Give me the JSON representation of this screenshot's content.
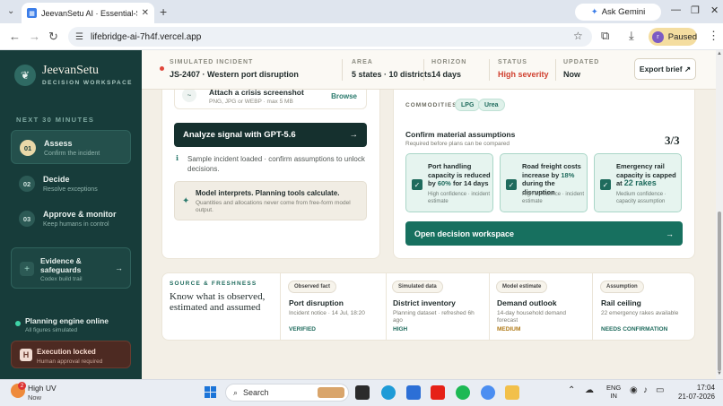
{
  "browser": {
    "tab_title": "JeevanSetu AI · Essential-Suppl",
    "ask_gemini": "Ask Gemini",
    "url": "lifebridge-ai-7h4f.vercel.app",
    "profile_initial": "r",
    "profile_status": "Paused"
  },
  "sidebar": {
    "brand": "JeevanSetu",
    "brand_sub": "DECISION WORKSPACE",
    "section": "NEXT 30 MINUTES",
    "steps": [
      {
        "num": "01",
        "label": "Assess",
        "sub": "Confirm the incident"
      },
      {
        "num": "02",
        "label": "Decide",
        "sub": "Resolve exceptions"
      },
      {
        "num": "03",
        "label": "Approve & monitor",
        "sub": "Keep humans in control"
      }
    ],
    "evidence": {
      "label": "Evidence & safeguards",
      "sub": "Codex build trail"
    },
    "engine": {
      "label": "Planning engine online",
      "sub": "All figures simulated"
    },
    "execution": {
      "label": "Execution locked",
      "sub": "Human approval required",
      "icon_letter": "H"
    }
  },
  "header": {
    "incident_label": "SIMULATED INCIDENT",
    "incident_value": "JS-2407 · Western port disruption",
    "area_label": "AREA",
    "area_value": "5 states · 10 districts",
    "horizon_label": "HORIZON",
    "horizon_value": "14 days",
    "status_label": "STATUS",
    "status_value": "High severity",
    "updated_label": "UPDATED",
    "updated_value": "Now",
    "export": "Export brief ↗",
    "status_color": "#d0402f"
  },
  "left_card": {
    "screenshot_title": "Attach a crisis screenshot",
    "screenshot_sub": "PNG, JPG or WEBP · max 5 MB",
    "browse": "Browse",
    "analyze": "Analyze signal with GPT-5.6",
    "info": "Sample incident loaded · confirm assumptions to unlock decisions.",
    "model_title": "Model interprets. Planning tools calculate.",
    "model_sub": "Quantities and allocations never come from free-form model output."
  },
  "right_card": {
    "commodities_label": "COMMODITIES",
    "commodities": [
      "LPG",
      "Urea"
    ],
    "confirm_title": "Confirm material assumptions",
    "confirm_sub": "Required before plans can be compared",
    "count": "3/3",
    "assumptions": [
      {
        "pre": "Port handling capacity is reduced by ",
        "em": "60%",
        "post": " for 14 days",
        "sub": "High confidence · incident estimate"
      },
      {
        "pre": "Road freight costs increase by ",
        "em": "18%",
        "post": " during the disruption",
        "sub": "High confidence · incident estimate"
      },
      {
        "pre": "Emergency rail capacity is capped at ",
        "em": "22 rakes",
        "post": "",
        "sub": "Medium confidence · capacity assumption"
      }
    ],
    "open": "Open decision workspace"
  },
  "sources": {
    "heading": "SOURCE & FRESHNESS",
    "title": "Know what is observed, estimated and assumed",
    "items": [
      {
        "badge": "Observed fact",
        "title": "Port disruption",
        "sub": "Incident notice · 14 Jul, 18:20",
        "status": "VERIFIED",
        "color": "#1f6b5d"
      },
      {
        "badge": "Simulated data",
        "title": "District inventory",
        "sub": "Planning dataset · refreshed 6h ago",
        "status": "HIGH",
        "color": "#1f6b5d"
      },
      {
        "badge": "Model estimate",
        "title": "Demand outlook",
        "sub": "14-day household demand forecast",
        "status": "MEDIUM",
        "color": "#b07a17"
      },
      {
        "badge": "Assumption",
        "title": "Rail ceiling",
        "sub": "22 emergency rakes available",
        "status": "NEEDS CONFIRMATION",
        "color": "#1f6b5d"
      }
    ]
  },
  "taskbar": {
    "weather_title": "High UV",
    "weather_sub": "Now",
    "weather_badge": "2",
    "search": "Search",
    "lang1": "ENG",
    "lang2": "IN",
    "time": "17:04",
    "date": "21-07-2026"
  },
  "colors": {
    "sidebar": "#173c3a",
    "accent": "#17705f",
    "danger": "#d0402f"
  }
}
